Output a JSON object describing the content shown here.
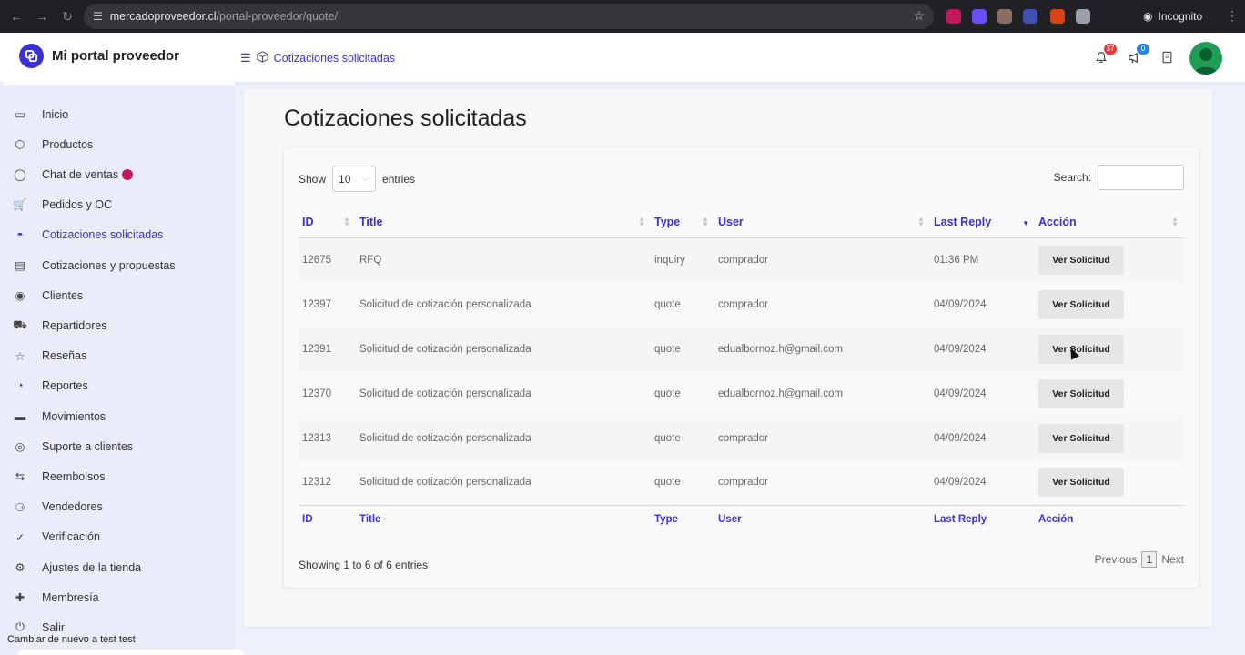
{
  "browser": {
    "url_host": "mercadoproveedor.cl",
    "url_path": "/portal-proveedor/quote/",
    "incognito_label": "Incognito",
    "extension_colors": [
      "#c2185b",
      "#6b4dff",
      "#8d6e63",
      "#3f51b5",
      "#d84315",
      "#9aa0a6"
    ]
  },
  "header": {
    "brand": "Mi portal proveedor",
    "breadcrumb": "Cotizaciones solicitadas",
    "notifications_count": "37",
    "announcements_count": "0",
    "brand_color": "#3d2fd6"
  },
  "sidebar": {
    "items": [
      {
        "label": "Inicio",
        "icon": "monitor-icon"
      },
      {
        "label": "Productos",
        "icon": "box-icon"
      },
      {
        "label": "Chat de ventas",
        "icon": "chat-icon"
      },
      {
        "label": "Pedidos y OC",
        "icon": "cart-icon"
      },
      {
        "label": "Cotizaciones solicitadas",
        "icon": "inbox-icon",
        "active": true
      },
      {
        "label": "Cotizaciones y propuestas",
        "icon": "document-icon"
      },
      {
        "label": "Clientes",
        "icon": "user-circle-icon"
      },
      {
        "label": "Repartidores",
        "icon": "truck-icon"
      },
      {
        "label": "Reseñas",
        "icon": "star-icon"
      },
      {
        "label": "Reportes",
        "icon": "pie-chart-icon"
      },
      {
        "label": "Movimientos",
        "icon": "money-icon"
      },
      {
        "label": "Suporte a clientes",
        "icon": "lifebuoy-icon"
      },
      {
        "label": "Reembolsos",
        "icon": "repeat-icon"
      },
      {
        "label": "Vendedores",
        "icon": "users-icon"
      },
      {
        "label": "Verificación",
        "icon": "check-circle-icon"
      },
      {
        "label": "Ajustes de la tienda",
        "icon": "settings-icon"
      },
      {
        "label": "Membresía",
        "icon": "user-plus-icon"
      },
      {
        "label": "Salir",
        "icon": "power-icon"
      }
    ],
    "switch_back": "Cambiar de nuevo a test test"
  },
  "main": {
    "title": "Cotizaciones solicitadas",
    "show_label": "Show",
    "entries_label": "entries",
    "page_length": "10",
    "search_label": "Search:",
    "search_value": "",
    "columns": [
      "ID",
      "Title",
      "Type",
      "User",
      "Last Reply",
      "Acción"
    ],
    "rows": [
      {
        "id": "12675",
        "title": "RFQ",
        "type": "inquiry",
        "user": "comprador",
        "last_reply": "01:36 PM",
        "action": "Ver Solicitud"
      },
      {
        "id": "12397",
        "title": "Solicitud de cotización personalizada",
        "type": "quote",
        "user": "comprador",
        "last_reply": "04/09/2024",
        "action": "Ver Solicitud"
      },
      {
        "id": "12391",
        "title": "Solicitud de cotización personalizada",
        "type": "quote",
        "user": "edualbornoz.h@gmail.com",
        "last_reply": "04/09/2024",
        "action": "Ver Solicitud"
      },
      {
        "id": "12370",
        "title": "Solicitud de cotización personalizada",
        "type": "quote",
        "user": "edualbornoz.h@gmail.com",
        "last_reply": "04/09/2024",
        "action": "Ver Solicitud"
      },
      {
        "id": "12313",
        "title": "Solicitud de cotización personalizada",
        "type": "quote",
        "user": "comprador",
        "last_reply": "04/09/2024",
        "action": "Ver Solicitud"
      },
      {
        "id": "12312",
        "title": "Solicitud de cotización personalizada",
        "type": "quote",
        "user": "comprador",
        "last_reply": "04/09/2024",
        "action": "Ver Solicitud"
      }
    ],
    "info": "Showing 1 to 6 of 6 entries",
    "previous": "Previous",
    "current_page": "1",
    "next": "Next"
  }
}
